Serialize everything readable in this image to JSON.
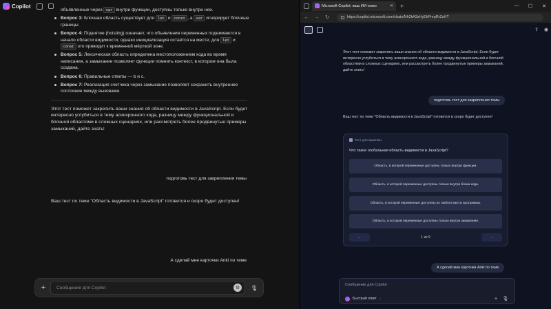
{
  "left": {
    "brand": "Copilot",
    "lines": {
      "l0a": "объявленные через ",
      "l0code": "var",
      "l0b": " внутри функции, доступны только внутри нее.",
      "q3_b": "Вопрос 3:",
      "q3_t1": " Блочная область существует для ",
      "q3_c1": "let",
      "q3_t2": " и ",
      "q3_c2": "const",
      "q3_t3": ", а ",
      "q3_c3": "var",
      "q3_t4": " игнорирует блочные границы.",
      "q4_b": "Вопрос 4:",
      "q4_t1": " Поднятие (hoisting) означает, что объявления переменных поднимаются в начало области видимости, однако инициализация остаётся на месте; для ",
      "q4_c1": "let",
      "q4_t2": " и ",
      "q4_c2": "const",
      "q4_t3": " это приводит к временной мёртвой зоне.",
      "q5_b": "Вопрос 5:",
      "q5_t": " Лексическая область определена местоположением кода во время написания, а замыкание позволяет функции помнить контекст, в котором она была создана.",
      "q6_b": "Вопрос 6:",
      "q6_t": " Правильные ответы — b и c.",
      "q7_b": "Вопрос 7:",
      "q7_t": " Реализация счетчика через замыкание позволяет сохранить внутреннее состояние между вызовами."
    },
    "summary": "Этот тест поможет закрепить ваши знания об области видимости в JavaScript. Если будет интересно углубиться в тему асинхронного кода, разницу между функциональной и блочной областями в сложных сценариях, или рассмотреть более продвинутые примеры замыканий, дайте знать!",
    "user_msg_1": "подготовь тест для закрепления темы",
    "answer": "Ваш тест по теме \"Область видимости в JavaScript\" готовится и скоро будет доступен!",
    "user_msg_2": "А сделай мне карточки Anki по теме",
    "composer_placeholder": "Сообщение для Copilot",
    "plus": "+",
    "gear": "⚙",
    "mic": "🎙"
  },
  "right": {
    "tab_title": "Microsoft Copilot: ваш ИИ-помо",
    "tab_close": "✕",
    "tab_new": "+",
    "win": [
      "—",
      "☐",
      "✕"
    ],
    "nav": [
      "←",
      "→",
      "↻"
    ],
    "url": "https://copilot.microsoft.com/chats/Nh2kA3zHyEkPnrpRrZzHT",
    "toolbar_right": [
      "⇧",
      "◉"
    ],
    "summary": "Этот тест поможет закрепить ваши знания об области видимости в JavaScript. Если будет интересно углубиться в тему асинхронного кода, разницу между функциональной и блочной областями в сложных сценариях, или рассмотреть более продвинутые примеры замыканий, дайте знать!",
    "user_msg_1": "подготовь тест для закрепления темы",
    "answer": "Ваш тест по теме \"Область видимости в JavaScript\" готовится и скоро будет доступен!",
    "quiz": {
      "label": "Тест для практики",
      "question": "Что такое глобальная область видимости в JavaScript?",
      "options": [
        "Область, в которой переменные доступны только внутри функции.",
        "Область, в которой переменные доступны только внутри блока кода.",
        "Область, в которой переменные доступны из любого места программы.",
        "Область, в которой переменные доступны только внутри замыкания."
      ],
      "prev": "←",
      "next": "→",
      "page": "1 из 9"
    },
    "user_msg_2": "А сделай мне карточки Anki по теме",
    "composer_placeholder": "Сообщение для Copilot",
    "mode": "Быстрый ответ",
    "mode_chevron": "⌄",
    "composer_plus": "+",
    "composer_mic": "🎙"
  }
}
